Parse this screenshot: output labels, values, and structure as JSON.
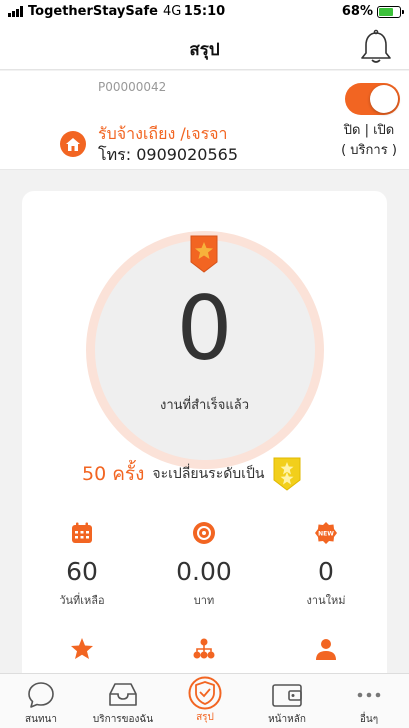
{
  "status_bar": {
    "carrier": "TogetherStaySafe",
    "network": "4G",
    "time": "15:10",
    "battery": "68%",
    "battery_level": 0.68
  },
  "header": {
    "title": "สรุป"
  },
  "provider": {
    "id": "P00000042",
    "service_name": "รับจ้างเถียง /เจรจา",
    "phone": "โทร: 0909020565",
    "toggle_line1": "ปิด | เปิด",
    "toggle_line2": "( บริการ )",
    "service_on": true
  },
  "summary": {
    "completed_count": "0",
    "completed_label": "งานที่สำเร็จแล้ว",
    "times_to_level": "50 ครั้ง",
    "level_text": "จะเปลี่ยนระดับเป็น"
  },
  "stats": [
    {
      "icon": "calendar-icon",
      "value": "60",
      "label": "วันที่เหลือ"
    },
    {
      "icon": "coin-icon",
      "value": "0.00",
      "label": "บาท"
    },
    {
      "icon": "new-icon",
      "value": "0",
      "label": "งานใหม่"
    }
  ],
  "quick_icons": [
    "star-icon",
    "network-icon",
    "person-icon"
  ],
  "tabs": [
    {
      "label": "สนทนา",
      "icon": "chat-icon",
      "active": false
    },
    {
      "label": "บริการของฉัน",
      "icon": "inbox-icon",
      "active": false
    },
    {
      "label": "สรุป",
      "icon": "summary-icon",
      "active": true
    },
    {
      "label": "หน้าหลัก",
      "icon": "wallet-icon",
      "active": false
    },
    {
      "label": "อื่นๆ",
      "icon": "more-icon",
      "active": false
    }
  ],
  "colors": {
    "accent": "#f26522",
    "gold": "#f2cf1b",
    "ring": "#fbe2d8"
  }
}
